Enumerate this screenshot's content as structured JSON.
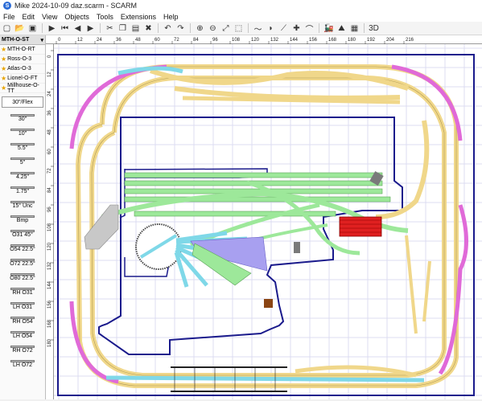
{
  "window": {
    "title": "Mike 2024-10-09 daz.scarm - SCARM"
  },
  "menu": [
    "File",
    "Edit",
    "View",
    "Objects",
    "Tools",
    "Extensions",
    "Help"
  ],
  "toolbar_icons": [
    "new-icon",
    "open-icon",
    "save-icon",
    "sep",
    "play-icon",
    "first-icon",
    "prev-icon",
    "next-icon",
    "sep",
    "cut-icon",
    "copy-icon",
    "paste-icon",
    "delete-icon",
    "sep",
    "undo-icon",
    "redo-icon",
    "sep",
    "zoom-in-icon",
    "zoom-out-icon",
    "zoom-fit-icon",
    "zoom-window-icon",
    "sep",
    "flex-icon",
    "tunnel-icon",
    "slope-icon",
    "cross-icon",
    "bridge-icon",
    "sep",
    "rolling-stock-icon",
    "terrain-icon",
    "grid-icon",
    "sep",
    "3d-icon"
  ],
  "sidebar": {
    "library_name": "MTH-O-ST",
    "favorites": [
      {
        "label": "MTH-O-RT"
      },
      {
        "label": "Ross-O-3"
      },
      {
        "label": "Atlas-O-3"
      },
      {
        "label": "Lionel-O-FT"
      },
      {
        "label": "Millhouse-O-TT"
      }
    ],
    "flex_label": "30\"/Flex",
    "pieces": [
      "30\"",
      "10\"",
      "5.5\"",
      "5\"",
      "4.25\"",
      "1.75\"",
      "15° Unc",
      "Bmp",
      "O31 45°",
      "O54 22.5°",
      "O72 22.5°",
      "O80 22.5°",
      "RH O31",
      "LH O31",
      "RH O54",
      "LH O54",
      "RH O72",
      "LH O72"
    ]
  },
  "ruler": {
    "top": [
      "0",
      "12",
      "24",
      "36",
      "48",
      "60",
      "72",
      "84",
      "96",
      "108",
      "120",
      "132",
      "144",
      "156",
      "168",
      "180",
      "192",
      "204",
      "216"
    ],
    "left": [
      "0",
      "12",
      "24",
      "36",
      "48",
      "60",
      "72",
      "84",
      "96",
      "108",
      "120",
      "132",
      "144",
      "156",
      "168",
      "180"
    ]
  },
  "colors": {
    "grid": "#dcdcf2",
    "boundary": "#1a1a8c",
    "track_yellow": "#f0d78a",
    "track_magenta": "#e06ad8",
    "track_cyan": "#7fd8e8",
    "track_green": "#9de89a",
    "yard_red": "#e02020"
  }
}
